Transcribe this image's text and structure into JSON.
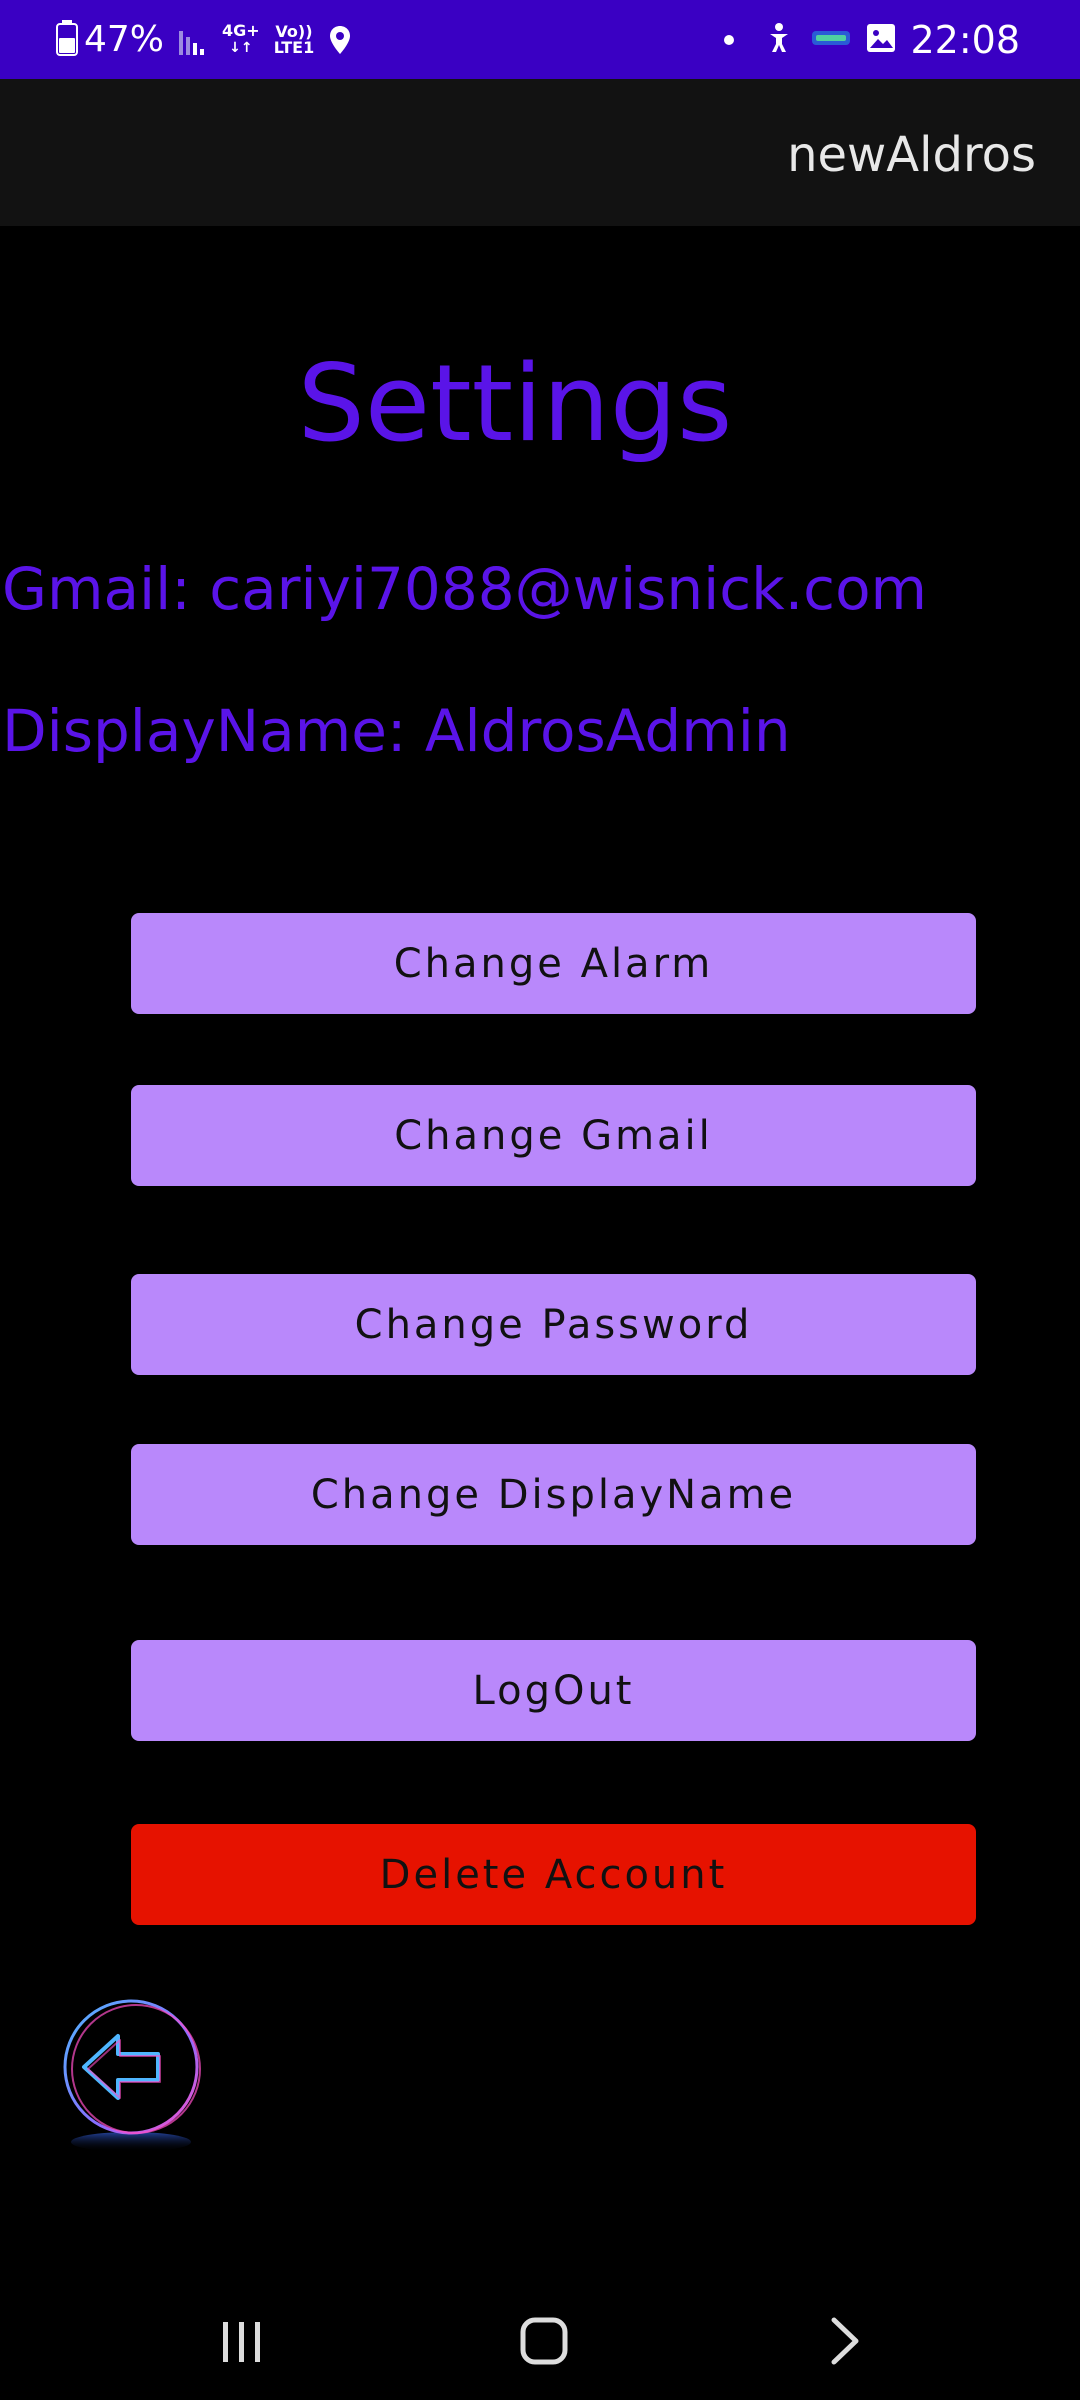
{
  "status_bar": {
    "battery": "47%",
    "network_top": "4G+",
    "volte_top": "Vo))",
    "volte_bottom": "LTE1",
    "time": "22:08",
    "colors": {
      "background": "#3a00c3"
    }
  },
  "app_bar": {
    "title": "newAldros"
  },
  "page": {
    "title": "Settings",
    "gmail_line": "Gmail: cariyi7088@wisnick.com",
    "display_name_line": "DisplayName: AldrosAdmin"
  },
  "buttons": {
    "change_alarm": "Change Alarm",
    "change_gmail": "Change Gmail",
    "change_password": "Change Password",
    "change_display_name": "Change DisplayName",
    "logout": "LogOut",
    "delete_account": "Delete Account"
  },
  "icons": {
    "back": "back-arrow-icon",
    "nav_recent": "recent-apps-icon",
    "nav_home": "home-icon",
    "nav_back": "chevron-right-icon"
  },
  "colors": {
    "accent_text": "#5a14e8",
    "button": "#b988fb",
    "danger": "#e61200",
    "app_bar": "#121212"
  }
}
